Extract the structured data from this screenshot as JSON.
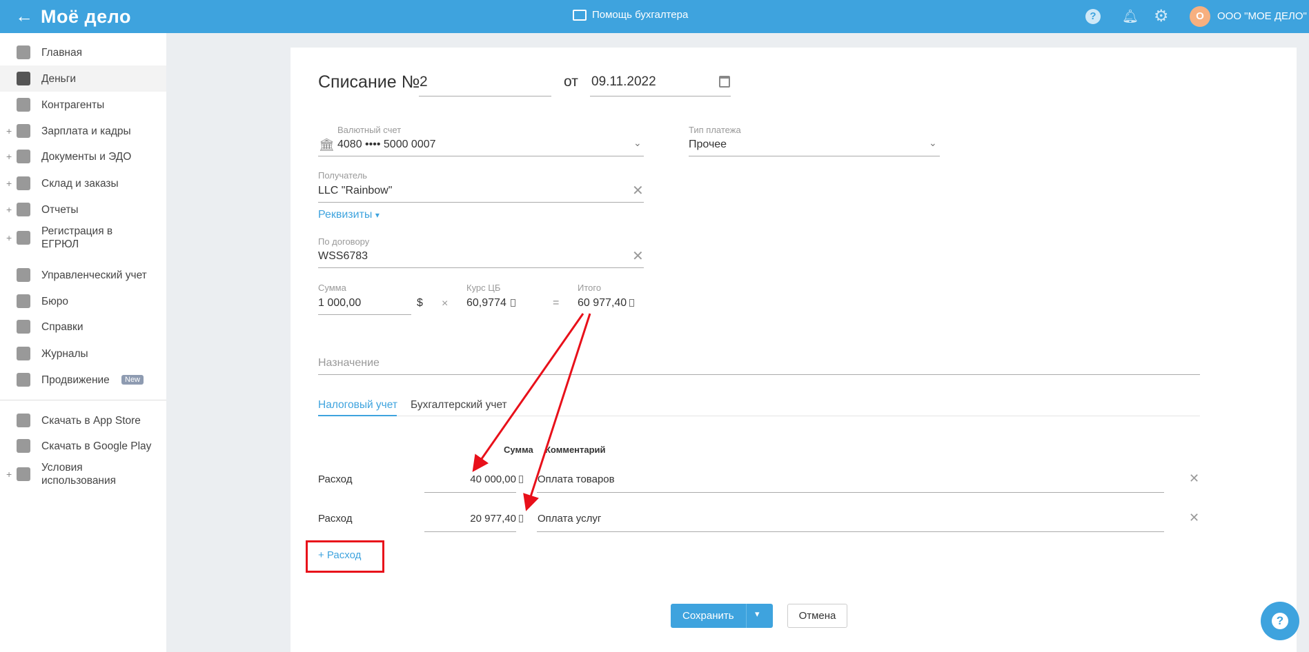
{
  "header": {
    "logo": "Моё дело",
    "center": "Помощь бухгалтера",
    "company": "ООО \"МОЕ ДЕЛО\"",
    "avatar_letter": "О"
  },
  "sidebar": {
    "items": [
      {
        "label": "Главная",
        "icon": "home-icon"
      },
      {
        "label": "Деньги",
        "icon": "money-icon",
        "active": true
      },
      {
        "label": "Контрагенты",
        "icon": "person-icon"
      },
      {
        "label": "Зарплата и кадры",
        "icon": "wallet-icon",
        "plus": true
      },
      {
        "label": "Документы и ЭДО",
        "icon": "folder-icon",
        "plus": true
      },
      {
        "label": "Склад и заказы",
        "icon": "warehouse-icon",
        "plus": true
      },
      {
        "label": "Отчеты",
        "icon": "report-icon",
        "plus": true
      },
      {
        "label": "Регистрация в ЕГРЮЛ",
        "icon": "registration-icon",
        "plus": true
      },
      {
        "label": "Управленческий учет",
        "icon": "ruble-doc-icon"
      },
      {
        "label": "Бюро",
        "icon": "briefcase-icon"
      },
      {
        "label": "Справки",
        "icon": "reference-icon"
      },
      {
        "label": "Журналы",
        "icon": "journal-icon"
      },
      {
        "label": "Продвижение",
        "icon": "chart-icon",
        "badge": "New"
      },
      {
        "label": "Скачать в App Store",
        "icon": "apple-icon"
      },
      {
        "label": "Скачать в Google Play",
        "icon": "google-play-icon"
      },
      {
        "label": "Условия использования",
        "icon": "more-icon",
        "plus": true
      }
    ]
  },
  "form": {
    "title": "Списание №",
    "number": "2",
    "from": "от",
    "date": "09.11.2022",
    "currency_account": {
      "label": "Валютный счет",
      "value": "4080 •••• 5000 0007"
    },
    "payment_type": {
      "label": "Тип платежа",
      "value": "Прочее"
    },
    "recipient": {
      "label": "Получатель",
      "value": "LLC \"Rainbow\""
    },
    "details_link": "Реквизиты",
    "contract": {
      "label": "По договору",
      "value": "WSS6783"
    },
    "sum": {
      "label": "Сумма",
      "value": "1 000,00",
      "currency": "$"
    },
    "times": "×",
    "rate": {
      "label": "Курс ЦБ",
      "value": "60,9774"
    },
    "equals": "=",
    "total": {
      "label": "Итого",
      "value": "60 977,40"
    },
    "purpose_placeholder": "Назначение",
    "tabs": [
      "Налоговый учет",
      "Бухгалтерский учет"
    ],
    "col_sum": "Сумма",
    "col_comment": "Комментарий",
    "rows": [
      {
        "type": "Расход",
        "amount": "40 000,00",
        "comment": "Оплата товаров"
      },
      {
        "type": "Расход",
        "amount": "20 977,40",
        "comment": "Оплата услуг"
      }
    ],
    "add_expense": "+ Расход",
    "save": "Сохранить",
    "cancel": "Отмена"
  },
  "colors": {
    "accent": "#3ea3de",
    "annotation": "#e8101a"
  }
}
